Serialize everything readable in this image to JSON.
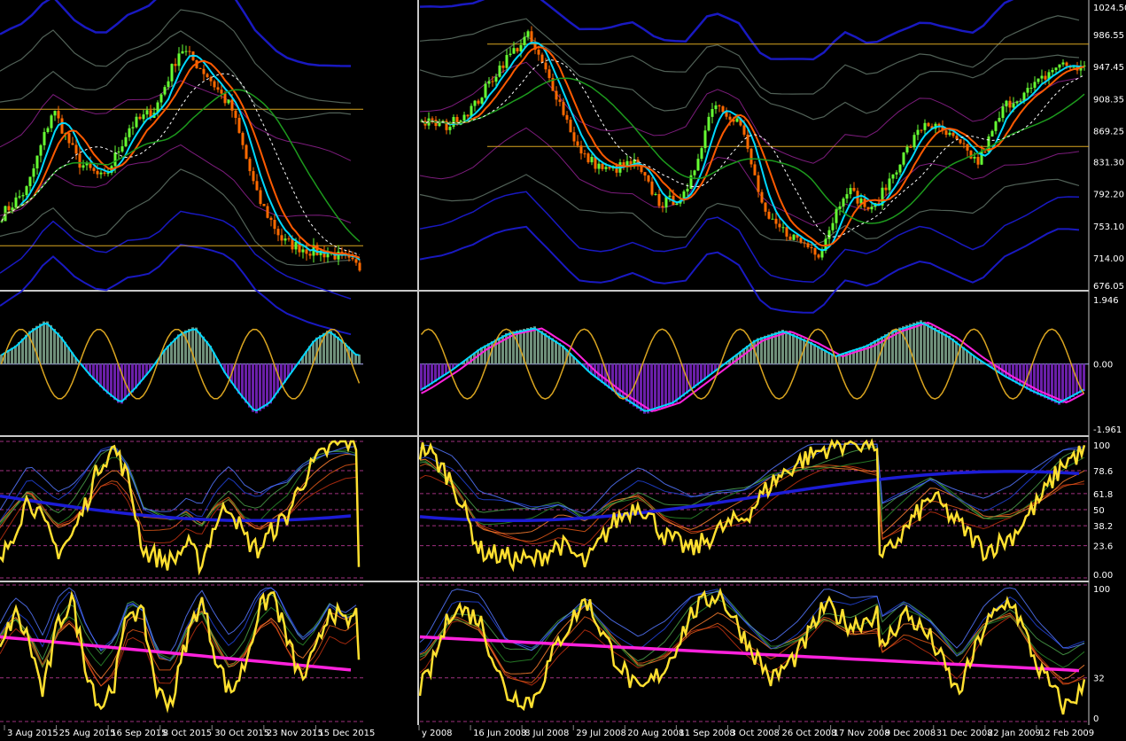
{
  "colors": {
    "background": "#000000",
    "separator": "#c8c8c8",
    "gold": "#daa520",
    "price_blue": "#1c1cd6",
    "price_grey": "#5a6b60",
    "candle_up": "#66ff33",
    "candle_down": "#ff6a00",
    "ma_fast": "#00d8ff",
    "ma_mid": "#ff5a00",
    "ma_slow": "#1d9a1d",
    "envelope": "#8a1f8a",
    "macd_up": "#6f8f7a",
    "macd_down": "#6a1fa8",
    "yellow": "#ffe030",
    "magenta": "#ff22dd",
    "level": "#a03080"
  },
  "chart_data": [
    {
      "type": "line",
      "panel": "left-price",
      "x_labels": [
        "3 Aug 2015",
        "25 Aug 2015",
        "16 Sep 2015",
        "8 Oct 2015",
        "30 Oct 2015",
        "23 Nov 2015",
        "15 Dec 2015"
      ],
      "series": [
        {
          "values": [
            760,
            790,
            880,
            820,
            800,
            860,
            880,
            950,
            920,
            880,
            780,
            730,
            720,
            715,
            700
          ]
        },
        {
          "values": [
            770,
            800,
            860,
            830,
            810,
            850,
            870,
            930,
            920,
            870,
            790,
            740,
            725,
            718,
            705
          ]
        }
      ],
      "horizontal_levels": [
        880,
        725
      ]
    },
    {
      "type": "line",
      "panel": "right-price",
      "x_labels": [
        "y 2008",
        "16 Jun 2008",
        "8 Jul 2008",
        "29 Jul 2008",
        "20 Aug 2008",
        "11 Sep 2008",
        "3 Oct 2008",
        "26 Oct 2008",
        "17 Nov 2008",
        "9 Dec 2008",
        "31 Dec 2008",
        "22 Jan 2009",
        "12 Feb 2009"
      ],
      "y_ticks": [
        "1024.50",
        "986.55",
        "947.45",
        "908.35",
        "869.25",
        "831.30",
        "792.20",
        "753.10",
        "714.00",
        "676.05"
      ],
      "ylim": [
        676.05,
        1024.5
      ],
      "series": [
        {
          "values": [
            880,
            875,
            900,
            950,
            985,
            920,
            840,
            820,
            830,
            780,
            790,
            905,
            880,
            760,
            740,
            720,
            800,
            770,
            830,
            880,
            860,
            830,
            900,
            920,
            950,
            945
          ]
        },
        {
          "values": [
            885,
            880,
            895,
            940,
            970,
            930,
            860,
            830,
            825,
            795,
            800,
            880,
            870,
            780,
            750,
            730,
            790,
            780,
            820,
            865,
            860,
            840,
            890,
            910,
            935,
            940
          ]
        }
      ],
      "horizontal_levels": [
        975,
        850
      ]
    },
    {
      "type": "bar",
      "panel": "macd",
      "y_ticks": [
        "1.946",
        "0.00",
        "-1.961"
      ],
      "ylim": [
        -1.961,
        1.946
      ],
      "series": [
        {
          "values": [
            0.3,
            0.6,
            1.1,
            1.4,
            0.9,
            0.2,
            -0.4,
            -0.9,
            -1.3,
            -0.8,
            -0.2,
            0.5,
            1.0,
            1.2,
            0.6,
            -0.3,
            -1.0,
            -1.6,
            -1.3,
            -0.6,
            0.1,
            0.8,
            1.1,
            0.7,
            0.2
          ]
        }
      ]
    },
    {
      "type": "line",
      "panel": "oscillator-1",
      "y_ticks": [
        "100",
        "78.6",
        "61.8",
        "50",
        "38.2",
        "23.6",
        "0.00"
      ],
      "ylim": [
        0,
        100
      ],
      "series": [
        {
          "values": [
            10,
            35,
            60,
            40,
            20,
            30,
            55,
            85,
            95,
            70,
            20,
            15,
            12,
            25,
            10,
            40,
            55,
            30,
            20,
            35,
            45,
            70,
            85,
            95,
            100,
            98
          ]
        }
      ]
    },
    {
      "type": "line",
      "panel": "oscillator-2",
      "y_ticks": [
        "100",
        "32",
        "0"
      ],
      "ylim": [
        0,
        100
      ],
      "series": [
        {
          "values": [
            50,
            80,
            60,
            20,
            70,
            90,
            40,
            10,
            30,
            85,
            75,
            20,
            15,
            60,
            90,
            50,
            20,
            40,
            80,
            95,
            60,
            30,
            50,
            85,
            70,
            80
          ]
        }
      ]
    }
  ]
}
